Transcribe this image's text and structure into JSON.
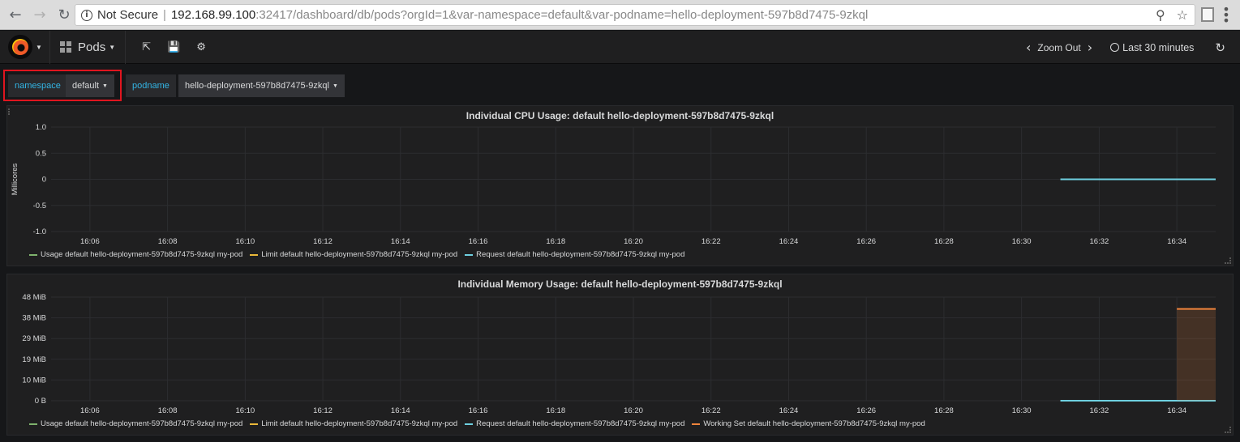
{
  "browser": {
    "not_secure": "Not Secure",
    "url_host": "192.168.99.100",
    "url_rest": ":32417/dashboard/db/pods?orgId=1&var-namespace=default&var-podname=hello-deployment-597b8d7475-9zkql"
  },
  "navbar": {
    "dashboard_title": "Pods",
    "zoom_out": "Zoom Out",
    "time_range": "Last 30 minutes"
  },
  "variables": [
    {
      "label": "namespace",
      "value": "default"
    },
    {
      "label": "podname",
      "value": "hello-deployment-597b8d7475-9zkql"
    }
  ],
  "icons": [
    "back-icon",
    "forward-icon",
    "reload-icon",
    "info-icon",
    "zoom-icon",
    "star-icon",
    "extension-icon",
    "menu-icon",
    "grafana-logo-icon",
    "dashboard-grid-icon",
    "share-icon",
    "save-icon",
    "settings-icon",
    "chevron-left-icon",
    "chevron-right-icon",
    "clock-icon",
    "refresh-icon"
  ],
  "colors": {
    "usage": "#7eb26d",
    "limit": "#eab839",
    "request": "#6ed0e0",
    "working_set": "#ef843c",
    "variable_label": "#33b5e5",
    "highlight": "#e0151f"
  },
  "chart_data": [
    {
      "type": "line",
      "title": "Individual CPU Usage: default hello-deployment-597b8d7475-9zkql",
      "ylabel": "Millicores",
      "xlabel": "",
      "ylim": [
        -1.0,
        1.0
      ],
      "y_ticks": [
        "1.0",
        "0.5",
        "0",
        "-0.5",
        "-1.0"
      ],
      "x_ticks": [
        "16:06",
        "16:08",
        "16:10",
        "16:12",
        "16:14",
        "16:16",
        "16:18",
        "16:20",
        "16:22",
        "16:24",
        "16:26",
        "16:28",
        "16:30",
        "16:32",
        "16:34"
      ],
      "grid": true,
      "legend": "bottom",
      "series": [
        {
          "name": "Usage default hello-deployment-597b8d7475-9zkql my-pod",
          "color": "#7eb26d",
          "points": []
        },
        {
          "name": "Limit default hello-deployment-597b8d7475-9zkql my-pod",
          "color": "#eab839",
          "points": []
        },
        {
          "name": "Request default hello-deployment-597b8d7475-9zkql my-pod",
          "color": "#6ed0e0",
          "points": [
            [
              "16:31",
              0
            ],
            [
              "16:35",
              0
            ]
          ]
        }
      ]
    },
    {
      "type": "line",
      "title": "Individual Memory Usage: default hello-deployment-597b8d7475-9zkql",
      "ylabel": "",
      "xlabel": "",
      "ylim": [
        0,
        48
      ],
      "y_unit": "MiB",
      "y_ticks": [
        "48 MiB",
        "38 MiB",
        "29 MiB",
        "19 MiB",
        "10 MiB",
        "0 B"
      ],
      "x_ticks": [
        "16:06",
        "16:08",
        "16:10",
        "16:12",
        "16:14",
        "16:16",
        "16:18",
        "16:20",
        "16:22",
        "16:24",
        "16:26",
        "16:28",
        "16:30",
        "16:32",
        "16:34"
      ],
      "grid": true,
      "legend": "bottom",
      "series": [
        {
          "name": "Usage default hello-deployment-597b8d7475-9zkql my-pod",
          "color": "#7eb26d",
          "points": []
        },
        {
          "name": "Limit default hello-deployment-597b8d7475-9zkql my-pod",
          "color": "#eab839",
          "points": []
        },
        {
          "name": "Request default hello-deployment-597b8d7475-9zkql my-pod",
          "color": "#6ed0e0",
          "points": [
            [
              "16:31",
              0
            ],
            [
              "16:35",
              0
            ]
          ]
        },
        {
          "name": "Working Set default hello-deployment-597b8d7475-9zkql my-pod",
          "color": "#ef843c",
          "fill": true,
          "points": [
            [
              "16:34",
              42.5
            ],
            [
              "16:35",
              42.5
            ]
          ]
        }
      ]
    }
  ]
}
